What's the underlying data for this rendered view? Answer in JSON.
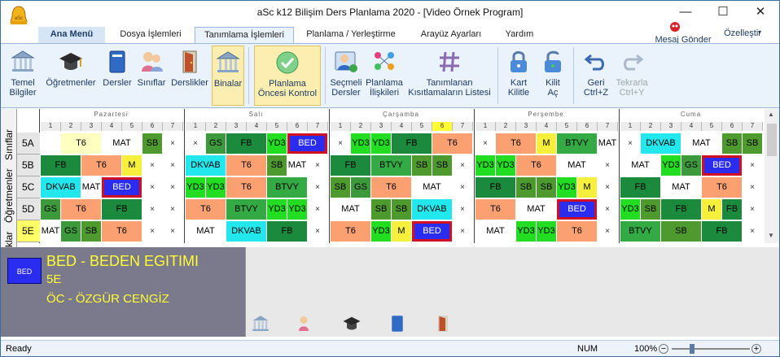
{
  "window": {
    "title": "aSc k12 Bilişim Ders Planlama 2020  - [Video Örnek Program]"
  },
  "menu": {
    "tabs": [
      "Ana Menü",
      "Dosya İşlemleri",
      "Tanımlama İşlemleri",
      "Planlama / Yerleştirme",
      "Arayüz Ayarları",
      "Yardım"
    ],
    "message": "Mesaj Gönder",
    "customize": "Özelleştir"
  },
  "ribbon": {
    "buttons": [
      "Temel\nBilgiler",
      "Öğretmenler",
      "Dersler",
      "Sınıflar",
      "Derslikler",
      "Binalar",
      "Planlama\nÖncesi Kontrol",
      "Seçmeli\nDersler",
      "Planlama\nİlişkileri",
      "Tanımlanan\nKısıtlamaların Listesi",
      "Kart\nKilitle",
      "Kilit\nAç",
      "Geri\nCtrl+Z",
      "Tekrarla\nCtrl+Y"
    ]
  },
  "side_tabs": [
    "Sınıflar",
    "Öğretmenler",
    "klar"
  ],
  "days": [
    "Pazartesi",
    "Salı",
    "Çarşamba",
    "Perşembe",
    "Cuma"
  ],
  "periods": [
    "1",
    "2",
    "3",
    "4",
    "5",
    "6",
    "7"
  ],
  "classes": [
    "5A",
    "5B",
    "5C",
    "5D",
    "5E"
  ],
  "cells": [
    [
      "",
      "T6",
      "",
      "MAT",
      "",
      "SB",
      "×",
      "×",
      "GS",
      "FB",
      "",
      "YD3",
      "BED",
      "",
      "×",
      "YD3",
      "YD3",
      "FB",
      "",
      "T6",
      "",
      "×",
      "T6",
      "",
      "M",
      "BTVY",
      "",
      "MAT",
      "×",
      "DKVAB",
      "",
      "MAT",
      "",
      "SB",
      "SB",
      "×"
    ],
    [
      "FB",
      "",
      "T6",
      "",
      "M",
      "×",
      "×",
      "DKVAB",
      "",
      "T6",
      "",
      "SB",
      "MAT",
      "×",
      "FB",
      "",
      "BTVY",
      "",
      "SB",
      "SB",
      "×",
      "YD3",
      "YD3",
      "T6",
      "",
      "MAT",
      "",
      "×",
      "MAT",
      "",
      "YD3",
      "GS",
      "BED",
      "",
      "×"
    ],
    [
      "DKVAB",
      "",
      "MAT",
      "BED",
      "",
      "×",
      "×",
      "YD3",
      "YD3",
      "T6",
      "",
      "BTVY",
      "",
      "×",
      "SB",
      "GS",
      "T6",
      "",
      "MAT",
      "",
      "×",
      "FB",
      "",
      "SB",
      "SB",
      "YD3",
      "M",
      "×",
      "FB",
      "",
      "MAT",
      "",
      "T6",
      "",
      "×"
    ],
    [
      "GS",
      "T6",
      "",
      "FB",
      "",
      "×",
      "×",
      "T6",
      "",
      "BTVY",
      "",
      "YD3",
      "YD3",
      "×",
      "MAT",
      "",
      "SB",
      "SB",
      "DKVAB",
      "",
      "×",
      "T6",
      "",
      "MAT",
      "",
      "BED",
      "",
      "×",
      "YD3",
      "SB",
      "FB",
      "",
      "M",
      "FB",
      "×"
    ],
    [
      "MAT",
      "GS",
      "SB",
      "T6",
      "",
      "×",
      "×",
      "MAT",
      "",
      "DKVAB",
      "",
      "FB",
      "",
      "×",
      "T6",
      "",
      "YD3",
      "M",
      "BED",
      "",
      "×",
      "MAT",
      "",
      "YD3",
      "YD3",
      "T6",
      "",
      "×",
      "BTVY",
      "",
      "SB",
      "",
      "FB",
      "",
      "×"
    ]
  ],
  "info": {
    "code": "BED",
    "subject": "BED - BEDEN EGITIMI",
    "class": "5E",
    "teacher": "ÖC - ÖZGÜR CENGİZ"
  },
  "status": {
    "left": "Ready",
    "num": "NUM",
    "zoom": "100%"
  }
}
